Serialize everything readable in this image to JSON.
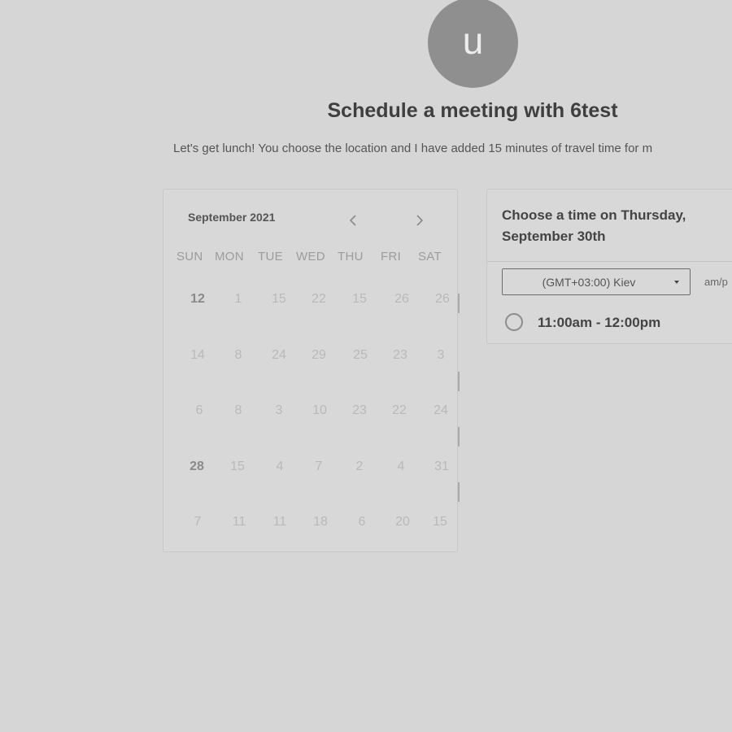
{
  "host": {
    "avatar_initial": "u"
  },
  "header": {
    "title": "Schedule a meeting with 6test",
    "subtitle": "Let's get lunch! You choose the location and I have added 15 minutes of travel time for m"
  },
  "calendar": {
    "month_label": "September 2021",
    "prev_icon": "chevron-left-icon",
    "next_icon": "chevron-right-icon",
    "weekdays": [
      "SUN",
      "MON",
      "TUE",
      "WED",
      "THU",
      "FRI",
      "SAT"
    ],
    "weeks": [
      [
        "12",
        "1",
        "15",
        "22",
        "15",
        "26",
        "26"
      ],
      [
        "14",
        "8",
        "24",
        "29",
        "25",
        "23",
        "3"
      ],
      [
        "6",
        "8",
        "3",
        "10",
        "23",
        "22",
        "24"
      ],
      [
        "28",
        "15",
        "4",
        "7",
        "2",
        "4",
        "31"
      ],
      [
        "7",
        "11",
        "11",
        "18",
        "6",
        "20",
        "15"
      ]
    ],
    "emphasized": [
      "12",
      "28"
    ]
  },
  "time_panel": {
    "heading": "Choose a time on Thursday, September 30th",
    "timezone": "(GMT+03:00) Kiev",
    "format_toggle": "am/p",
    "slots": [
      "11:00am - 12:00pm"
    ]
  },
  "colors": {
    "background": "#d6d6d6",
    "avatar": "#8f8f8f",
    "text": "#444444",
    "muted_text": "#b9b9b9"
  }
}
